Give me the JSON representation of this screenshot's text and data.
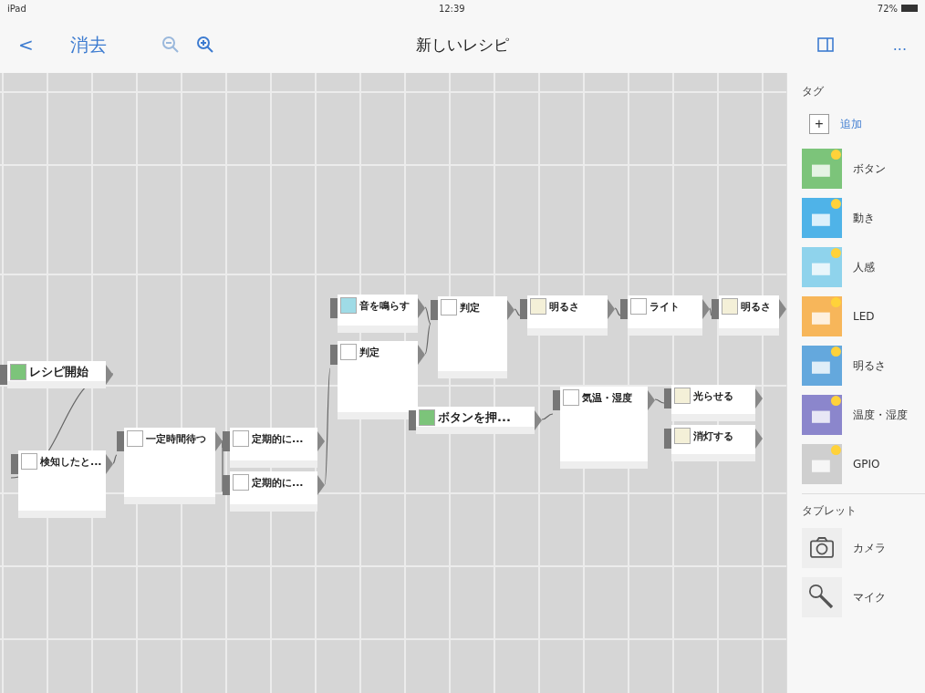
{
  "status_bar": {
    "device": "iPad",
    "time": "12:39",
    "battery": "72%"
  },
  "nav": {
    "back": "<",
    "clear": "消去",
    "title": "新しいレシピ",
    "more": "..."
  },
  "nodes": [
    {
      "kind": "button",
      "title": "レシピ開始"
    },
    {
      "kind": "motion",
      "title": "検知したと..."
    },
    {
      "kind": "timer",
      "title": "一定時間待つ"
    },
    {
      "kind": "timer",
      "title": "定期的に..."
    },
    {
      "kind": "timer",
      "title": "定期的に..."
    },
    {
      "kind": "sound",
      "title": "音を鳴らす"
    },
    {
      "kind": "logic",
      "title": "判定"
    },
    {
      "kind": "logic",
      "title": "判定"
    },
    {
      "kind": "led",
      "title": "明るさ"
    },
    {
      "kind": "logic",
      "title": "ライト"
    },
    {
      "kind": "led",
      "title": "明るさ"
    },
    {
      "kind": "button",
      "title": "ボタンを押..."
    },
    {
      "kind": "temp",
      "title": "気温・湿度"
    },
    {
      "kind": "led",
      "title": "光らせる"
    },
    {
      "kind": "led",
      "title": "消灯する"
    }
  ],
  "sidebar": {
    "tags_heading": "タグ",
    "add_icon": "+",
    "add_label": "追加",
    "tags": [
      {
        "kind": "button",
        "label": "ボタン"
      },
      {
        "kind": "move",
        "label": "動き"
      },
      {
        "kind": "motion",
        "label": "人感"
      },
      {
        "kind": "led",
        "label": "LED"
      },
      {
        "kind": "bright",
        "label": "明るさ"
      },
      {
        "kind": "temp",
        "label": "温度・湿度"
      },
      {
        "kind": "gpio",
        "label": "GPIO"
      }
    ],
    "tablet_heading": "タブレット",
    "tablet": [
      {
        "kind": "camera",
        "label": "カメラ"
      },
      {
        "kind": "mic",
        "label": "マイク"
      }
    ]
  }
}
